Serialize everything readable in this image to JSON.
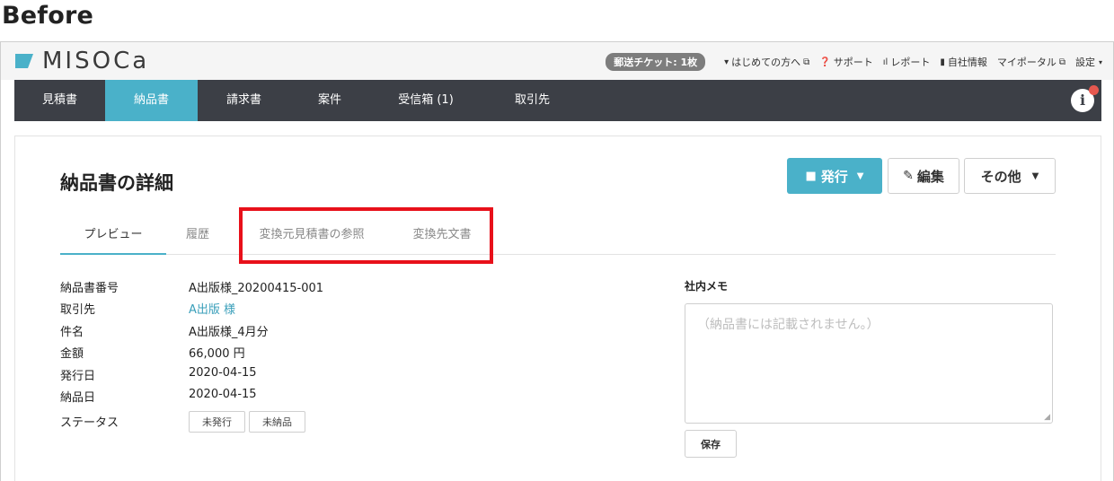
{
  "heading": "Before",
  "app": {
    "logo_text": "MISOCa",
    "brand_color": "#4ab1c9",
    "nav_color": "#3c3f46",
    "highlight_color": "#e8101a"
  },
  "topbar": {
    "ticket": "郵送チケット: 1枚",
    "links": [
      {
        "icon": "book-icon",
        "glyph": "▾",
        "label": "はじめての方へ",
        "external": "⧉"
      },
      {
        "icon": "help-icon",
        "glyph": "❓",
        "label": "サポート"
      },
      {
        "icon": "report-icon",
        "glyph": "ıl",
        "label": "レポート"
      },
      {
        "icon": "building-icon",
        "glyph": "▮",
        "label": "自社情報"
      },
      {
        "label": "マイポータル",
        "external": "⧉"
      },
      {
        "label": "設定",
        "caret": "▾"
      }
    ]
  },
  "nav": {
    "items": [
      "見積書",
      "納品書",
      "請求書",
      "案件",
      "受信箱 (1)",
      "取引先"
    ],
    "active": "納品書",
    "info_glyph": "i"
  },
  "page": {
    "title": "納品書の詳細",
    "buttons": {
      "issue": "発行",
      "edit": "編集",
      "other": "その他"
    },
    "tabs": [
      "プレビュー",
      "履歴",
      "変換元見積書の参照",
      "変換先文書"
    ],
    "active_tab": "プレビュー"
  },
  "details": [
    {
      "label": "納品書番号",
      "value": "A出版様_20200415-001"
    },
    {
      "label": "取引先",
      "value": "A出版 様",
      "link": true
    },
    {
      "label": "件名",
      "value": "A出版様_4月分"
    },
    {
      "label": "金額",
      "value": "66,000 円"
    },
    {
      "label": "発行日",
      "value": "2020-04-15"
    },
    {
      "label": "納品日",
      "value": "2020-04-15"
    }
  ],
  "status": {
    "label": "ステータス",
    "chips": [
      "未発行",
      "未納品"
    ]
  },
  "memo": {
    "label": "社内メモ",
    "placeholder": "（納品書には記載されません。）",
    "save": "保存"
  }
}
